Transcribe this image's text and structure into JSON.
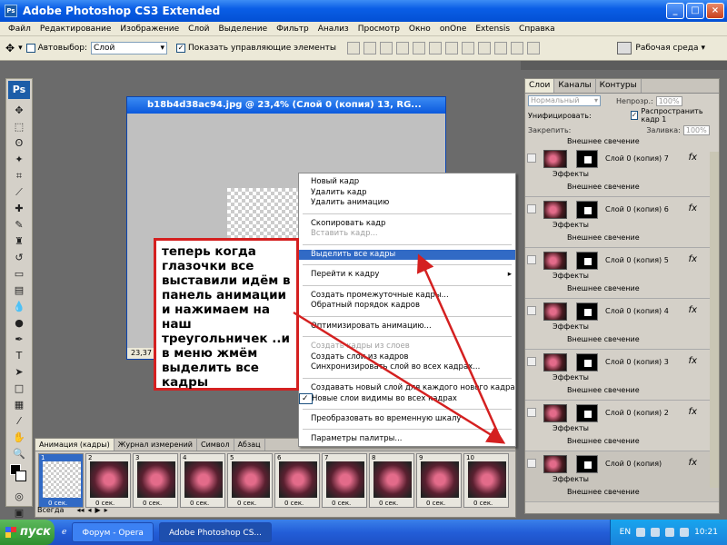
{
  "app": {
    "title": "Adobe Photoshop CS3 Extended",
    "logo": "Ps"
  },
  "menubar": [
    "Файл",
    "Редактирование",
    "Изображение",
    "Слой",
    "Выделение",
    "Фильтр",
    "Анализ",
    "Просмотр",
    "Окно",
    "onOne",
    "Extensis",
    "Справка"
  ],
  "options": {
    "auto_select_label": "Автовыбор:",
    "auto_select_value": "Слой",
    "show_transform_label": "Показать управляющие элементы",
    "workspace_label": "Рабочая среда"
  },
  "document": {
    "title": "b18b4d38ac94.jpg @ 23,4% (Слой 0 (копия) 13, RG...",
    "zoom": "23,37"
  },
  "context_menu": {
    "items": [
      {
        "label": "Новый кадр",
        "state": "normal"
      },
      {
        "label": "Удалить кадр",
        "state": "normal"
      },
      {
        "label": "Удалить анимацию",
        "state": "normal"
      },
      {
        "sep": true
      },
      {
        "label": "Скопировать кадр",
        "state": "normal"
      },
      {
        "label": "Вставить кадр...",
        "state": "disabled"
      },
      {
        "sep": true
      },
      {
        "label": "Выделить все кадры",
        "state": "highlighted"
      },
      {
        "sep": true
      },
      {
        "label": "Перейти к кадру",
        "state": "submenu"
      },
      {
        "sep": true
      },
      {
        "label": "Создать промежуточные кадры...",
        "state": "normal"
      },
      {
        "label": "Обратный порядок кадров",
        "state": "normal"
      },
      {
        "sep": true
      },
      {
        "label": "Оптимизировать анимацию...",
        "state": "normal"
      },
      {
        "sep": true
      },
      {
        "label": "Создать кадры из слоев",
        "state": "disabled"
      },
      {
        "label": "Создать слои из кадров",
        "state": "normal"
      },
      {
        "label": "Синхронизировать слой во всех кадрах...",
        "state": "normal"
      },
      {
        "sep": true
      },
      {
        "label": "Создавать новый слой для каждого нового кадра",
        "state": "normal"
      },
      {
        "label": "Новые слои видимы во всех кадрах",
        "state": "checked"
      },
      {
        "sep": true
      },
      {
        "label": "Преобразовать во временную шкалу",
        "state": "normal"
      },
      {
        "sep": true
      },
      {
        "label": "Параметры палитры...",
        "state": "normal"
      }
    ]
  },
  "tutorial_note": "теперь когда глазочки все выставили идём в панель анимации и нажимаем на наш треугольничек ..и в меню жмём выделить все кадры",
  "layers_panel": {
    "tabs": [
      "Слои",
      "Каналы",
      "Контуры"
    ],
    "blend_mode": "Нормальный",
    "opacity_label": "Непрозр.:",
    "opacity_value": "100%",
    "unify_label": "Унифицировать:",
    "propagate_label": "Распространить кадр 1",
    "lock_label": "Закрепить:",
    "fill_label": "Заливка:",
    "fill_value": "100%",
    "top_glow": "Внешнее свечение",
    "layers": [
      {
        "name": "Слой 0 (копия) 7",
        "effects": "Эффекты",
        "glow": "Внешнее свечение"
      },
      {
        "name": "Слой 0 (копия) 6",
        "effects": "Эффекты",
        "glow": "Внешнее свечение"
      },
      {
        "name": "Слой 0 (копия) 5",
        "effects": "Эффекты",
        "glow": "Внешнее свечение"
      },
      {
        "name": "Слой 0 (копия) 4",
        "effects": "Эффекты",
        "glow": "Внешнее свечение"
      },
      {
        "name": "Слой 0 (копия) 3",
        "effects": "Эффекты",
        "glow": "Внешнее свечение"
      },
      {
        "name": "Слой 0 (копия) 2",
        "effects": "Эффекты",
        "glow": "Внешнее свечение"
      },
      {
        "name": "Слой 0 (копия)",
        "effects": "Эффекты",
        "glow": "Внешнее свечение"
      }
    ]
  },
  "animation_panel": {
    "tabs": [
      "Анимация (кадры)",
      "Журнал измерений",
      "Символ",
      "Абзац"
    ],
    "frames": [
      {
        "num": "1",
        "delay": "0 сек."
      },
      {
        "num": "2",
        "delay": "0 сек."
      },
      {
        "num": "3",
        "delay": "0 сек."
      },
      {
        "num": "4",
        "delay": "0 сек."
      },
      {
        "num": "5",
        "delay": "0 сек."
      },
      {
        "num": "6",
        "delay": "0 сек."
      },
      {
        "num": "7",
        "delay": "0 сек."
      },
      {
        "num": "8",
        "delay": "0 сек."
      },
      {
        "num": "9",
        "delay": "0 сек."
      },
      {
        "num": "10",
        "delay": "0 сек."
      }
    ],
    "loop": "Всегда"
  },
  "taskbar": {
    "start": "пуск",
    "tasks": [
      "Форум - Opera",
      "Adobe Photoshop CS..."
    ],
    "lang": "EN",
    "time": "10:21"
  }
}
